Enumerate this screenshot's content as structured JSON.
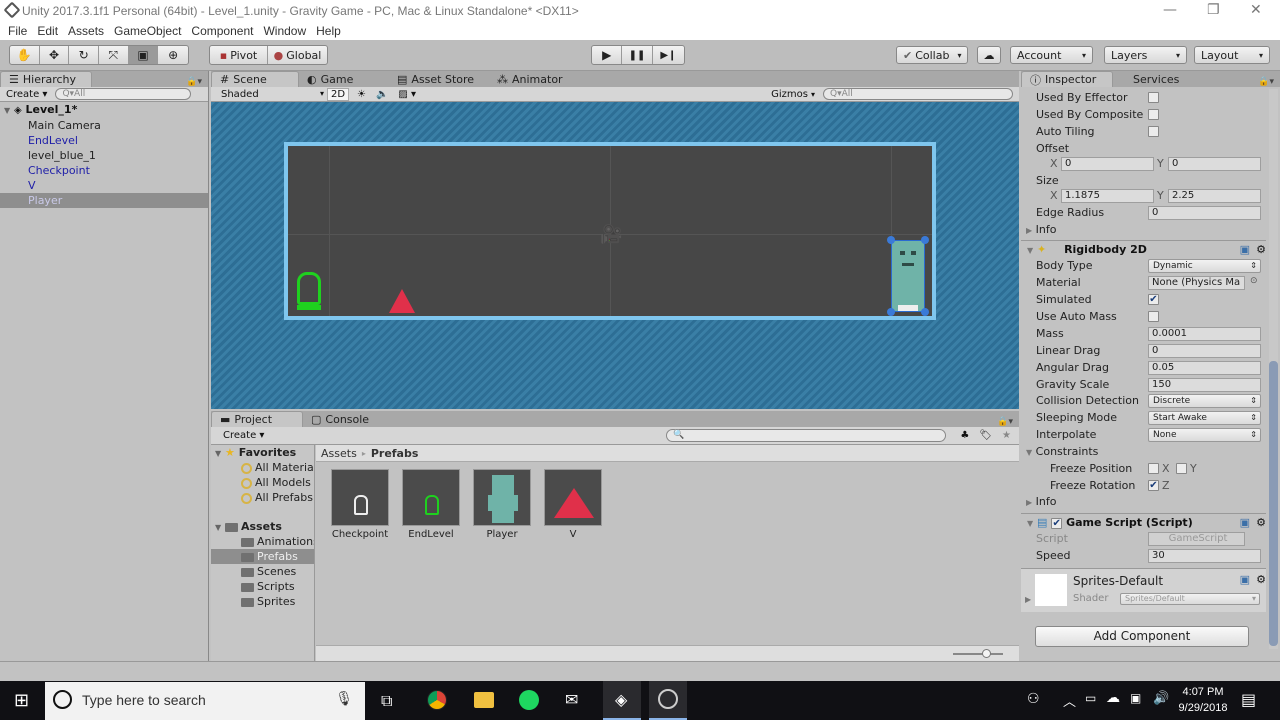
{
  "window": {
    "title": "Unity 2017.3.1f1 Personal (64bit) - Level_1.unity - Gravity Game - PC, Mac & Linux Standalone* <DX11>",
    "minimize": "—",
    "restore": "❐",
    "close": "✕"
  },
  "menu": [
    "File",
    "Edit",
    "Assets",
    "GameObject",
    "Component",
    "Window",
    "Help"
  ],
  "toolbar": {
    "tools": [
      {
        "icon": "hand-tool-icon",
        "glyph": "✋"
      },
      {
        "icon": "move-tool-icon",
        "glyph": "✥"
      },
      {
        "icon": "rotate-tool-icon",
        "glyph": "↻"
      },
      {
        "icon": "scale-tool-icon",
        "glyph": "⤧"
      },
      {
        "icon": "rect-tool-icon",
        "glyph": "▣"
      },
      {
        "icon": "transform-tool-icon",
        "glyph": "⊕"
      }
    ],
    "pivot": "Pivot",
    "global": "Global",
    "play": "▶",
    "pause": "❚❚",
    "step": "▶❙",
    "collab": "Collab",
    "account": "Account",
    "layers": "Layers",
    "layout": "Layout"
  },
  "hierarchy": {
    "tab": "Hierarchy",
    "create": "Create",
    "search_placeholder": "Q▾All",
    "scene": "Level_1*",
    "items": [
      {
        "label": "Main Camera",
        "type": "normal"
      },
      {
        "label": "EndLevel",
        "type": "prefab"
      },
      {
        "label": "level_blue_1",
        "type": "normal"
      },
      {
        "label": "Checkpoint",
        "type": "prefab"
      },
      {
        "label": "V",
        "type": "prefab"
      },
      {
        "label": "Player",
        "type": "selected"
      }
    ]
  },
  "scene": {
    "tabs": [
      "Scene",
      "Game",
      "Asset Store",
      "Animator"
    ],
    "shading": "Shaded",
    "mode2d": "2D",
    "gizmos": "Gizmos",
    "search_placeholder": "Q▾All"
  },
  "project": {
    "tabs": [
      "Project",
      "Console"
    ],
    "create": "Create",
    "favorites": "Favorites",
    "favorite_items": [
      "All Materials",
      "All Models",
      "All Prefabs"
    ],
    "assets_root": "Assets",
    "folders": [
      "Animations",
      "Prefabs",
      "Scenes",
      "Scripts",
      "Sprites"
    ],
    "selected_folder": "Prefabs",
    "breadcrumb": [
      "Assets",
      "Prefabs"
    ],
    "assets": [
      "Checkpoint",
      "EndLevel",
      "Player",
      "V"
    ],
    "thumbnail_zoom": 0.6
  },
  "inspector": {
    "tabs": [
      "Inspector",
      "Services"
    ],
    "collider": {
      "used_by_effector": {
        "label": "Used By Effector",
        "checked": false
      },
      "used_by_composite": {
        "label": "Used By Composite",
        "checked": false
      },
      "auto_tiling": {
        "label": "Auto Tiling",
        "checked": false
      },
      "offset_label": "Offset",
      "offset_x": "0",
      "offset_y": "0",
      "size_label": "Size",
      "size_x": "1.1875",
      "size_y": "2.25",
      "edge_radius_label": "Edge Radius",
      "edge_radius": "0",
      "info": "Info"
    },
    "rigidbody": {
      "title": "Rigidbody 2D",
      "body_type_label": "Body Type",
      "body_type": "Dynamic",
      "material_label": "Material",
      "material": "None (Physics Ma",
      "simulated_label": "Simulated",
      "simulated": true,
      "use_auto_mass_label": "Use Auto Mass",
      "use_auto_mass": false,
      "mass_label": "Mass",
      "mass": "0.0001",
      "linear_drag_label": "Linear Drag",
      "linear_drag": "0",
      "angular_drag_label": "Angular Drag",
      "angular_drag": "0.05",
      "gravity_scale_label": "Gravity Scale",
      "gravity_scale": "150",
      "collision_label": "Collision Detection",
      "collision": "Discrete",
      "sleeping_label": "Sleeping Mode",
      "sleeping": "Start Awake",
      "interpolate_label": "Interpolate",
      "interpolate": "None",
      "constraints": "Constraints",
      "freeze_position_label": "Freeze Position",
      "freeze_position_x": false,
      "freeze_position_y": false,
      "freeze_rotation_label": "Freeze Rotation",
      "freeze_rotation_z": true,
      "x": "X",
      "y": "Y",
      "z": "Z",
      "info": "Info"
    },
    "script": {
      "title": "Game Script (Script)",
      "enabled": true,
      "script_label": "Script",
      "script": "GameScript",
      "speed_label": "Speed",
      "speed": "30"
    },
    "material": {
      "name": "Sprites-Default",
      "shader_label": "Shader",
      "shader": "Sprites/Default"
    },
    "add_component": "Add Component"
  },
  "taskbar": {
    "search_placeholder": "Type here to search",
    "time": "4:07 PM",
    "date": "9/29/2018"
  },
  "colors": {
    "level_border": "#7fc6ee",
    "level_bg": "#474747",
    "endlevel_green": "#1fd11f",
    "spike_red": "#e0304a",
    "player_teal": "#6fb3a8",
    "prefab_text": "#1e1ea8"
  }
}
